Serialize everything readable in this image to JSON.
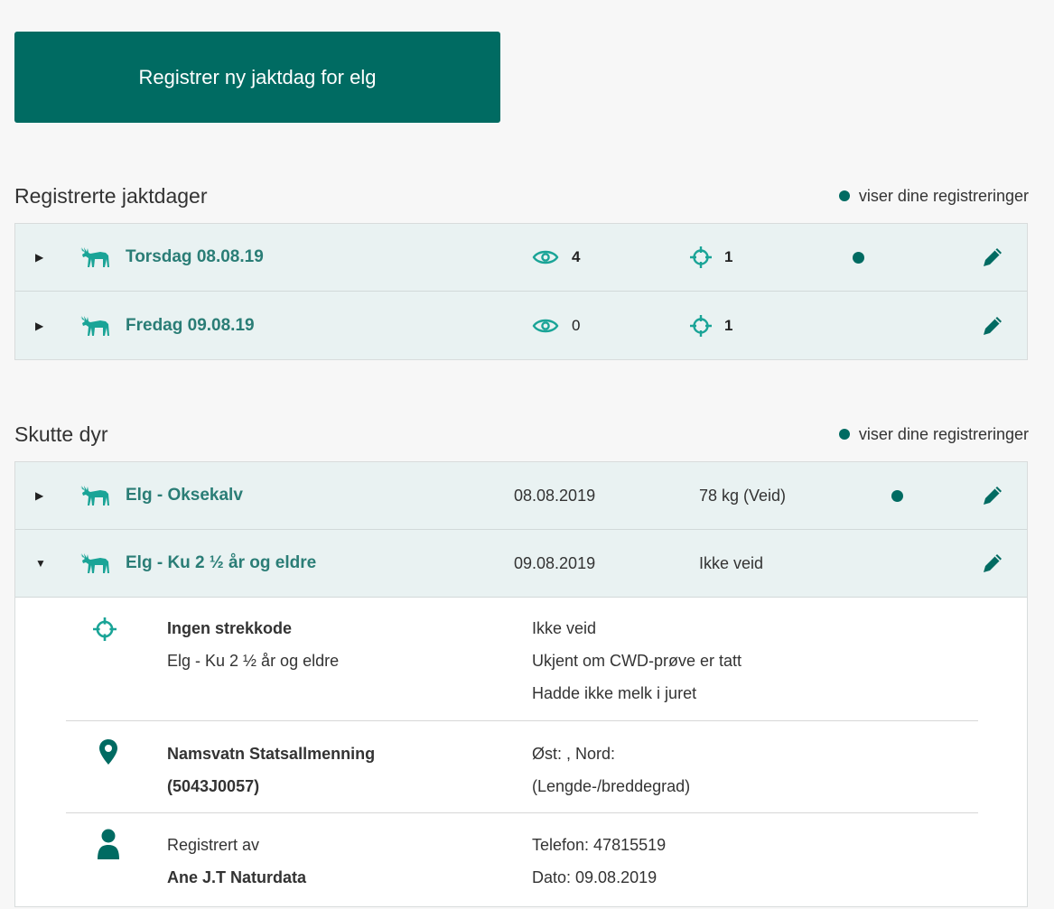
{
  "register_button": "Registrer ny jaktdag for elg",
  "jaktdager": {
    "title": "Registrerte jaktdager",
    "legend": "viser dine registreringer",
    "rows": [
      {
        "label": "Torsdag 08.08.19",
        "observed": "4",
        "shot": "1",
        "own": true
      },
      {
        "label": "Fredag 09.08.19",
        "observed": "0",
        "shot": "1",
        "own": false
      }
    ]
  },
  "skutte": {
    "title": "Skutte dyr",
    "legend": "viser dine registreringer",
    "rows": [
      {
        "label": "Elg - Oksekalv",
        "date": "08.08.2019",
        "weight": "78 kg (Veid)",
        "own": true,
        "expanded": false
      },
      {
        "label": "Elg - Ku 2 ½ år og eldre",
        "date": "09.08.2019",
        "weight": "Ikke veid",
        "own": false,
        "expanded": true
      }
    ],
    "detail": {
      "barcode_title": "Ingen strekkode",
      "animal_type": "Elg - Ku 2 ½ år og eldre",
      "weight_status": "Ikke veid",
      "cwd_status": "Ukjent om CWD-prøve er tatt",
      "milk_status": "Hadde ikke melk i juret",
      "area_name": "Namsvatn Statsallmenning",
      "area_code": "(5043J0057)",
      "coordinates": "Øst: , Nord:",
      "coord_type": "(Lengde-/breddegrad)",
      "registered_by_label": "Registrert av",
      "registered_by_name": "Ane J.T Naturdata",
      "phone": "Telefon: 47815519",
      "date": "Dato: 09.08.2019"
    }
  },
  "colors": {
    "accent": "#006b62",
    "row_bg": "#e9f2f2",
    "title_text": "#2a7d76",
    "icon": "#1aa497"
  },
  "icons": {
    "moose": "moose-icon",
    "eye": "eye-icon",
    "crosshair": "crosshair-icon",
    "pencil": "pencil-icon",
    "pin": "map-pin-icon",
    "person": "person-icon"
  }
}
